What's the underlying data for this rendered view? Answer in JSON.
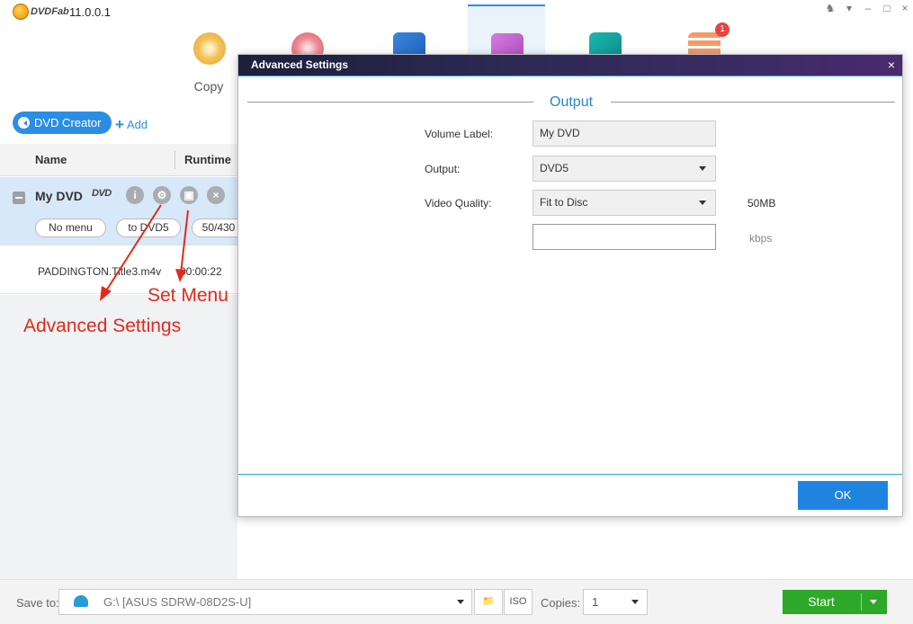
{
  "app": {
    "logo_text": "DVDFab",
    "version": "11.0.0.1"
  },
  "modules": [
    {
      "label": "Copy",
      "icon": "copy-disc-icon"
    },
    {
      "label": "",
      "icon": "ripper-disc-icon"
    },
    {
      "label": "",
      "icon": "video-converter-icon"
    },
    {
      "label": "",
      "icon": "dvd-creator-icon"
    },
    {
      "label": "",
      "icon": "utility-icon"
    },
    {
      "label": "",
      "icon": "task-queue-icon",
      "badge": "1"
    }
  ],
  "toolbar": {
    "creator_label": "DVD Creator",
    "add_label": "Add"
  },
  "list": {
    "headers": [
      "Name",
      "Runtime"
    ],
    "title": {
      "name": "My DVD",
      "disc_logo": "DVD",
      "buttons": [
        "i",
        "",
        "",
        "×"
      ],
      "pills": [
        "No menu",
        "to DVD5",
        "50/430"
      ]
    },
    "file": {
      "name": "PADDINGTON.Title3.m4v",
      "runtime": "00:00:22"
    }
  },
  "annotations": {
    "set_menu": "Set Menu",
    "advanced_settings": "Advanced Settings"
  },
  "dialog": {
    "title": "Advanced Settings",
    "close": "×",
    "section": "Output",
    "fields": [
      {
        "label": "Volume Label:",
        "value": "My DVD"
      },
      {
        "label": "Output:",
        "value": "DVD5"
      },
      {
        "label": "Video Quality:",
        "value": "Fit to Disc",
        "note": "50MB"
      },
      {
        "label": "",
        "value": "",
        "note": "kbps"
      }
    ],
    "ok_label": "OK"
  },
  "bottom": {
    "save_label": "Save to:",
    "save_path": "G:\\ [ASUS SDRW-08D2S-U]",
    "copies_label": "Copies:",
    "copies_value": "1",
    "start_label": "Start",
    "iso_label": "ISO"
  },
  "colors": {
    "accent": "#2b8ee5",
    "start": "#2ea829",
    "annotation": "#e22a1c",
    "dialog_title": "#2e2a55"
  }
}
